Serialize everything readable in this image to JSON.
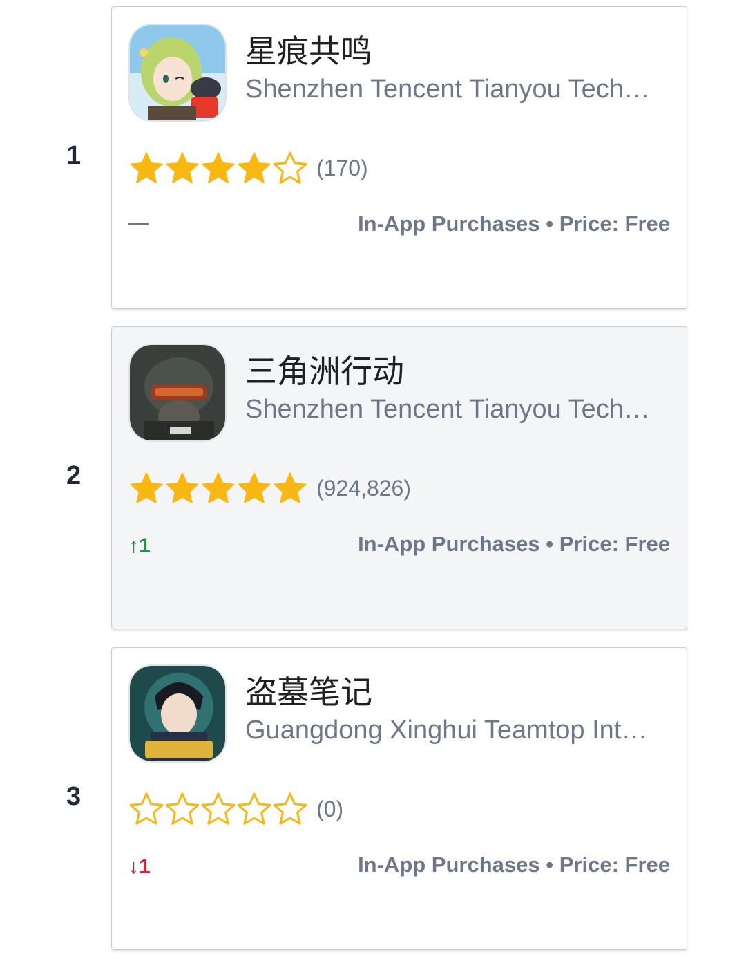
{
  "colors": {
    "star": "#f8b711",
    "up": "#2e8b4e",
    "down": "#c8283a",
    "muted": "#6e7787"
  },
  "apps": [
    {
      "rank": "1",
      "name": "星痕共鸣",
      "developer": "Shenzhen Tencent Tianyou Tech…",
      "rating": 4,
      "rating_count": "(170)",
      "rank_change": "—",
      "in_app": "In-App Purchases",
      "separator": "•",
      "price": "Price: Free"
    },
    {
      "rank": "2",
      "name": "三角洲行动",
      "developer": "Shenzhen Tencent Tianyou Tech…",
      "rating": 5,
      "rating_count": "(924,826)",
      "rank_change": "↑1",
      "in_app": "In-App Purchases",
      "separator": "•",
      "price": "Price: Free"
    },
    {
      "rank": "3",
      "name": "盗墓笔记",
      "developer": "Guangdong Xinghui Teamtop Int…",
      "rating": 0,
      "rating_count": "(0)",
      "rank_change": "↓1",
      "in_app": "In-App Purchases",
      "separator": "•",
      "price": "Price: Free"
    }
  ]
}
